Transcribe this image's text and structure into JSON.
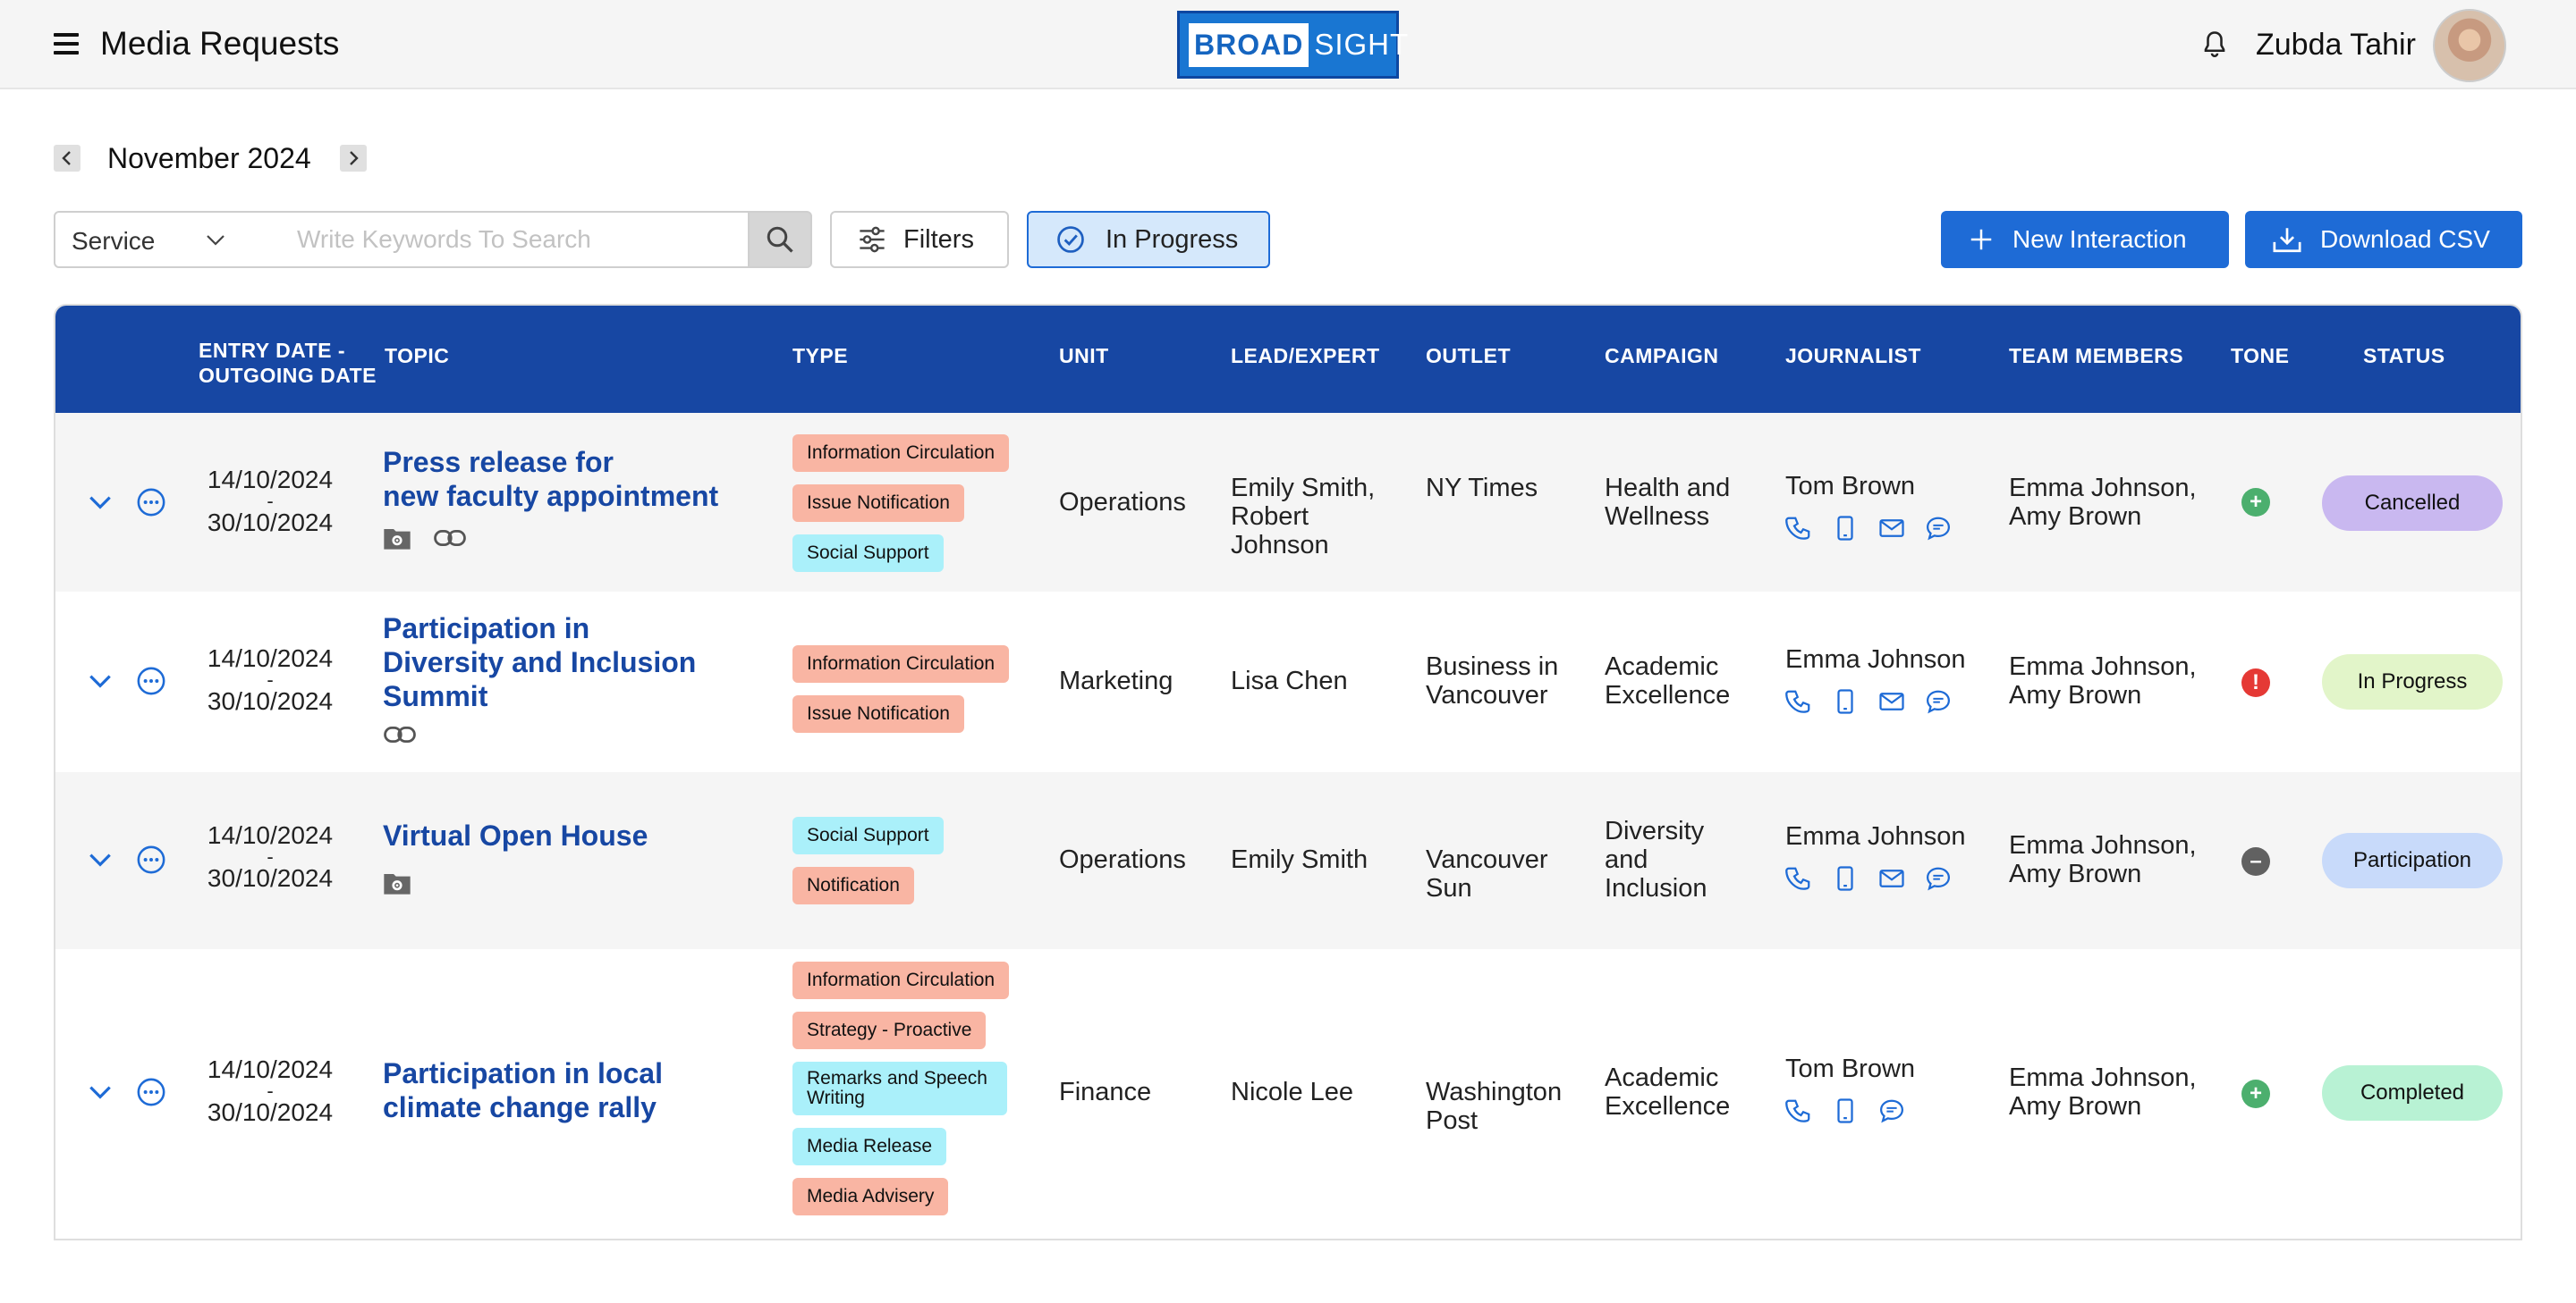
{
  "header": {
    "title": "Media Requests",
    "logo_left": "BROAD",
    "logo_right": "SIGHT",
    "user_name": "Zubda Tahir"
  },
  "month_nav": {
    "label": "November 2024"
  },
  "toolbar": {
    "service_label": "Service",
    "search_placeholder": "Write Keywords To Search",
    "filters_label": "Filters",
    "in_progress_label": "In Progress",
    "new_interaction_label": "New Interaction",
    "download_csv_label": "Download CSV"
  },
  "table": {
    "headers": {
      "entry_date_line1": "ENTRY DATE -",
      "entry_date_line2": "OUTGOING DATE",
      "topic": "TOPIC",
      "type": "TYPE",
      "unit": "UNIT",
      "lead": "LEAD/EXPERT",
      "outlet": "OUTLET",
      "campaign": "CAMPAIGN",
      "journalist": "JOURNALIST",
      "team": "TEAM MEMBERS",
      "tone": "TONE",
      "status": "STATUS"
    },
    "rows": [
      {
        "entry_date": "14/10/2024",
        "outgoing_date": "30/10/2024",
        "topic_line1": "Press release for",
        "topic_line2": "new faculty appointment",
        "types": [
          "Information Circulation",
          "Issue Notification",
          "Social Support"
        ],
        "unit": "Operations",
        "lead_line1": "Emily Smith,",
        "lead_line2": "Robert",
        "lead_line3": "Johnson",
        "outlet_line1": "NY Times",
        "campaign_line1": "Health and",
        "campaign_line2": "Wellness",
        "journalist": "Tom Brown",
        "team_line1": "Emma Johnson,",
        "team_line2": "Amy Brown",
        "tone": "positive",
        "status": "Cancelled"
      },
      {
        "entry_date": "14/10/2024",
        "outgoing_date": "30/10/2024",
        "topic_line1": "Participation in",
        "topic_line2": "Diversity and Inclusion",
        "topic_line3": "Summit",
        "types": [
          "Information Circulation",
          "Issue Notification"
        ],
        "unit": "Marketing",
        "lead_line1": "Lisa Chen",
        "outlet_line1": "Business in",
        "outlet_line2": "Vancouver",
        "campaign_line1": "Academic",
        "campaign_line2": "Excellence",
        "journalist": "Emma Johnson",
        "team_line1": "Emma Johnson,",
        "team_line2": "Amy Brown",
        "tone": "negative",
        "status": "In Progress"
      },
      {
        "entry_date": "14/10/2024",
        "outgoing_date": "30/10/2024",
        "topic_line1": "Virtual Open House",
        "types": [
          "Social Support",
          "Notification"
        ],
        "unit": "Operations",
        "lead_line1": "Emily Smith",
        "outlet_line1": "Vancouver",
        "outlet_line2": "Sun",
        "campaign_line1": "Diversity",
        "campaign_line2": "and",
        "campaign_line3": "Inclusion",
        "journalist": "Emma Johnson",
        "team_line1": "Emma Johnson,",
        "team_line2": "Amy Brown",
        "tone": "neutral",
        "status": "Participation"
      },
      {
        "entry_date": "14/10/2024",
        "outgoing_date": "30/10/2024",
        "topic_line1": "Participation in local",
        "topic_line2": "climate change rally",
        "types": [
          "Information Circulation",
          "Strategy - Proactive",
          "Remarks and Speech Writing",
          "Media Release",
          "Media Advisery"
        ],
        "unit": "Finance",
        "lead_line1": "Nicole Lee",
        "outlet_line1": "Washington",
        "outlet_line2": "Post",
        "campaign_line1": "Academic",
        "campaign_line2": "Excellence",
        "journalist": "Tom Brown",
        "team_line1": "Emma Johnson,",
        "team_line2": "Amy Brown",
        "tone": "positive",
        "status": "Completed"
      }
    ]
  },
  "icons": {
    "menu": "hamburger-icon",
    "bell": "bell-icon",
    "search": "search-icon",
    "filters": "sliders-icon",
    "in_progress": "check-circle-icon",
    "new": "plus-icon",
    "download": "download-icon",
    "expand": "chevron-down-icon",
    "more": "more-horizontal-icon",
    "folder": "folder-gear-icon",
    "link": "link-icon",
    "phone": "phone-icon",
    "mobile": "mobile-icon",
    "email": "mail-icon",
    "chat": "chat-icon"
  },
  "colors": {
    "header_bar": "#1747a3",
    "primary_button": "#1e6bd6",
    "topic_link": "#1747a3",
    "tag_salmon": "#f9b5a3",
    "tag_cyan": "#aaf0fa",
    "status_cancelled": "#c9b8f0",
    "status_in_progress": "#e2f5c9",
    "status_participation": "#c8dafa",
    "status_completed": "#b8f2d4",
    "tone_positive": "#4caf6e",
    "tone_negative": "#e53935",
    "tone_neutral": "#616161"
  }
}
